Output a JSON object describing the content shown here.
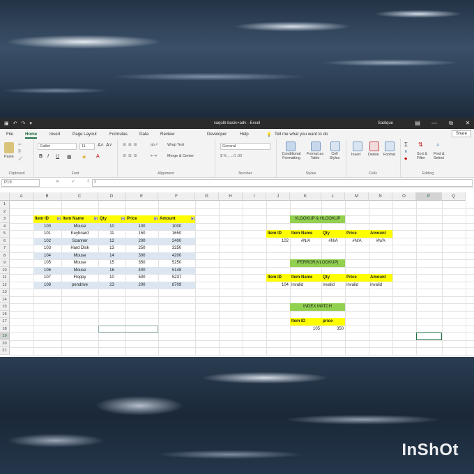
{
  "window": {
    "doc_title": "saqulb basic+adv  -  Excel",
    "user": "Sadique",
    "controls": [
      "—",
      "▢",
      "⧉",
      "✕"
    ]
  },
  "menu": {
    "tabs": [
      "File",
      "Home",
      "Insert",
      "Page Layout",
      "Formulas",
      "Data",
      "Review",
      "Developer",
      "Help"
    ],
    "active": "Home",
    "tell_me": "Tell me what you want to do",
    "share": "Share"
  },
  "ribbon": {
    "clipboard": {
      "paste": "Paste",
      "label": "Clipboard"
    },
    "font": {
      "name": "Calibri",
      "size": "11",
      "bold": "B",
      "italic": "I",
      "underline": "U",
      "label": "Font"
    },
    "alignment": {
      "wrap": "Wrap Text",
      "merge": "Merge & Center",
      "label": "Alignment"
    },
    "number": {
      "format": "General",
      "label": "Number"
    },
    "styles": {
      "conditional": "Conditional Formatting",
      "format_table": "Format as Table",
      "cell_styles": "Cell Styles",
      "label": "Styles"
    },
    "cells": {
      "insert": "Insert",
      "delete": "Delete",
      "format": "Format",
      "label": "Cells"
    },
    "editing": {
      "sort": "Sort & Filter",
      "find": "Find & Select",
      "label": "Editing"
    }
  },
  "formula_bar": {
    "name_box": "P19",
    "fx": "✕ ✓ fx",
    "value": ""
  },
  "columns": [
    "A",
    "B",
    "C",
    "D",
    "E",
    "F",
    "G",
    "H",
    "I",
    "J",
    "K",
    "L",
    "M",
    "N",
    "O",
    "P",
    "Q"
  ],
  "rows": [
    "1",
    "2",
    "3",
    "4",
    "5",
    "6",
    "7",
    "8",
    "9",
    "10",
    "11",
    "12",
    "13",
    "14",
    "15",
    "16",
    "17",
    "18",
    "19",
    "20",
    "21"
  ],
  "main_table": {
    "headers": [
      "Item ID",
      "Item Name",
      "Qty",
      "Price",
      "Amount"
    ],
    "rows": [
      [
        "100",
        "Mouse",
        "10",
        "100",
        "1000"
      ],
      [
        "101",
        "Keyboard",
        "11",
        "150",
        "1650"
      ],
      [
        "102",
        "Scanner",
        "12",
        "200",
        "2400"
      ],
      [
        "103",
        "Hard Disk",
        "13",
        "250",
        "3250"
      ],
      [
        "104",
        "Mouse",
        "14",
        "300",
        "4200"
      ],
      [
        "105",
        "Mouse",
        "15",
        "350",
        "5250"
      ],
      [
        "106",
        "Mouse",
        "16",
        "400",
        "5148"
      ],
      [
        "107",
        "Floppy",
        "10",
        "500",
        "5237"
      ],
      [
        "108",
        "pendrive",
        "23",
        "200",
        "8709"
      ]
    ]
  },
  "vlookup": {
    "title": "VLOOKUP & HLOOKUP",
    "headers": [
      "Item ID",
      "Item Name",
      "Qty",
      "Price",
      "Amount"
    ],
    "values": [
      "102",
      "#N/A",
      "#N/A",
      "#N/A",
      "#N/A"
    ]
  },
  "iferror": {
    "title": "IFERROR(VLOOKUP)",
    "headers": [
      "Item ID",
      "Item Name",
      "Qty",
      "Price",
      "Amount"
    ],
    "values": [
      "104",
      "invalid",
      "invalid",
      "invalid",
      "invalid"
    ]
  },
  "index_match": {
    "title": "INDEX MATCH",
    "headers": [
      "Item ID",
      "price"
    ],
    "values": [
      "105",
      "350"
    ]
  },
  "watermark": "InShOt"
}
